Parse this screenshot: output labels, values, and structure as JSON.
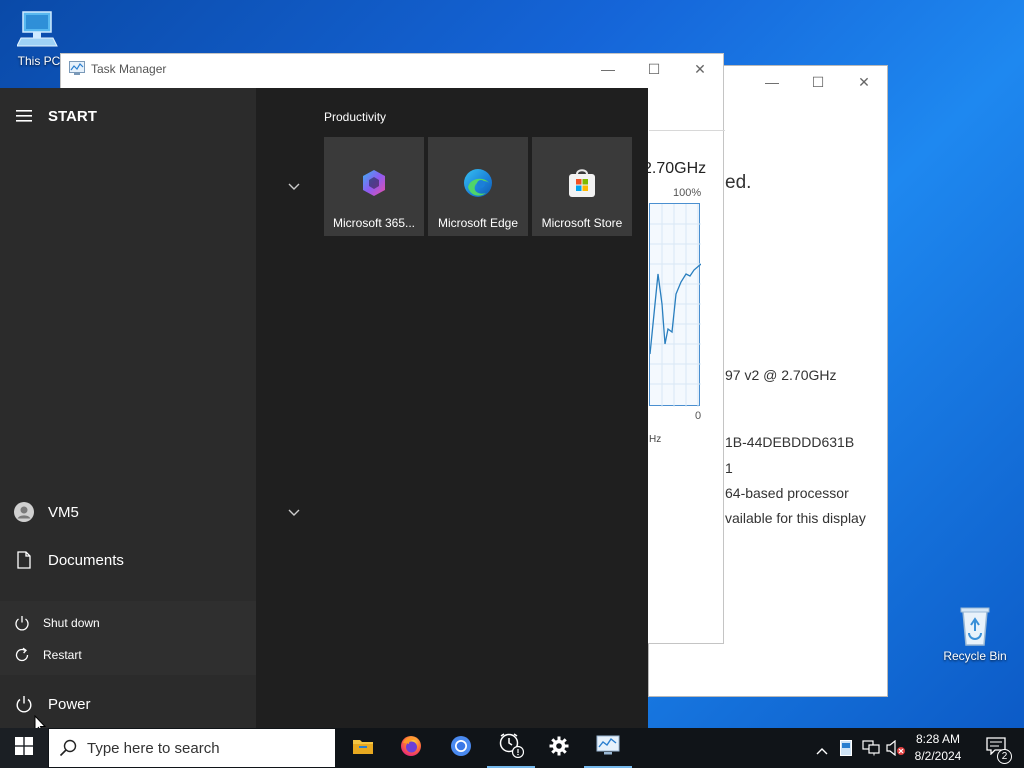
{
  "desktop": {
    "icons": [
      {
        "label": "This PC"
      },
      {
        "label": "Recycle Bin"
      }
    ]
  },
  "back_window": {
    "texts": [
      "ed.",
      "97 v2 @ 2.70GHz",
      "1B-44DEBDDD631B",
      "1",
      "64-based processor",
      "vailable for this display"
    ]
  },
  "task_manager": {
    "title": "Task Manager",
    "cpu_speed": "2.70GHz",
    "graph_max": "100%",
    "graph_min": "0",
    "graph_note": "Hz"
  },
  "start_menu": {
    "header": "START",
    "group_title": "Productivity",
    "tiles": [
      {
        "label": "Microsoft 365...",
        "icon": "microsoft-365-icon"
      },
      {
        "label": "Microsoft Edge",
        "icon": "edge-icon"
      },
      {
        "label": "Microsoft Store",
        "icon": "store-icon"
      }
    ],
    "user": "VM5",
    "documents": "Documents",
    "power_options": [
      "Shut down",
      "Restart"
    ],
    "power": "Power"
  },
  "taskbar": {
    "search_placeholder": "Type here to search",
    "time": "8:28 AM",
    "date": "8/2/2024",
    "notification_count": "2",
    "pinned": [
      "file-explorer-icon",
      "firefox-icon",
      "chrome-icon",
      "alarms-clock-icon",
      "settings-icon",
      "task-manager-icon"
    ]
  },
  "colors": {
    "start_left": "#2b2b2b",
    "start_right": "#1f1f1f",
    "tile": "#3a3a3a",
    "taskbar": "#101418",
    "accent": "#0078d4"
  }
}
